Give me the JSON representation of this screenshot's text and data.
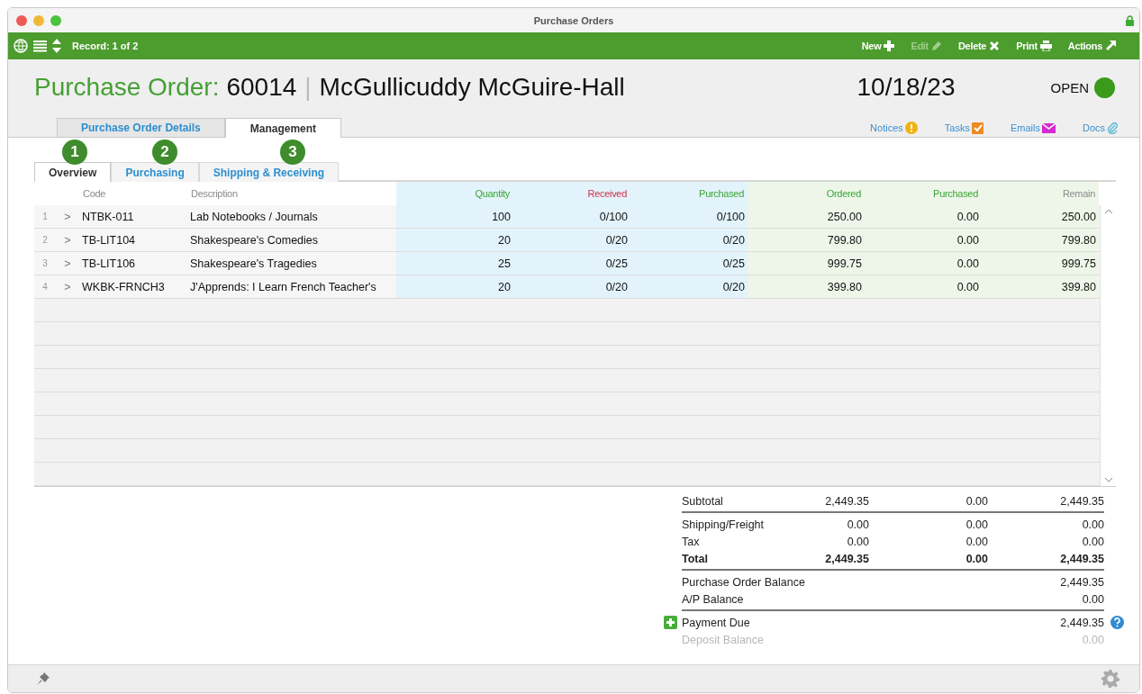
{
  "window": {
    "title": "Purchase Orders"
  },
  "toolbar": {
    "record": "Record: 1 of 2",
    "actions": [
      {
        "label": "New",
        "kind": "new",
        "disabled": false
      },
      {
        "label": "Edit",
        "kind": "edit",
        "disabled": true
      },
      {
        "label": "Delete",
        "kind": "delete",
        "disabled": false
      },
      {
        "label": "Print",
        "kind": "print",
        "disabled": false
      },
      {
        "label": "Actions",
        "kind": "actions",
        "disabled": false
      }
    ]
  },
  "header": {
    "label": "Purchase Order:",
    "number": "60014",
    "separator": "|",
    "vendor": "McGullicuddy McGuire-Hall",
    "date": "10/18/23",
    "status": "OPEN"
  },
  "links": [
    {
      "label": "Notices",
      "kind": "notices"
    },
    {
      "label": "Tasks",
      "kind": "tasks"
    },
    {
      "label": "Emails",
      "kind": "emails"
    },
    {
      "label": "Docs",
      "kind": "docs"
    }
  ],
  "tabs": [
    {
      "label": "Purchase Order Details",
      "selected": false
    },
    {
      "label": "Management",
      "selected": true
    }
  ],
  "subtabs": [
    {
      "label": "Overview",
      "selected": true
    },
    {
      "label": "Purchasing",
      "selected": false
    },
    {
      "label": "Shipping & Receiving",
      "selected": false
    }
  ],
  "callouts": [
    "1",
    "2",
    "3"
  ],
  "table": {
    "columns": [
      {
        "label": "Code",
        "color": "#8a8a8a",
        "kind": "text"
      },
      {
        "label": "Description",
        "color": "#8a8a8a",
        "kind": "text"
      },
      {
        "label": "Quantity",
        "color": "#3aa535",
        "kind": "quantity"
      },
      {
        "label": "Received",
        "color": "#d0314a",
        "kind": "quantity"
      },
      {
        "label": "Purchased",
        "color": "#3aa535",
        "kind": "quantity"
      },
      {
        "label": "Ordered",
        "color": "#3aa535",
        "kind": "amount"
      },
      {
        "label": "Purchased",
        "color": "#3aa535",
        "kind": "amount"
      },
      {
        "label": "Remain",
        "color": "#8a8a8a",
        "kind": "amount"
      }
    ],
    "rows": [
      {
        "num": "1",
        "expander": ">",
        "cells": [
          "NTBK-011",
          "Lab Notebooks / Journals",
          "100",
          "0/100",
          "0/100",
          "250.00",
          "0.00",
          "250.00"
        ]
      },
      {
        "num": "2",
        "expander": ">",
        "cells": [
          "TB-LIT104",
          "Shakespeare's Comedies",
          "20",
          "0/20",
          "0/20",
          "799.80",
          "0.00",
          "799.80"
        ]
      },
      {
        "num": "3",
        "expander": ">",
        "cells": [
          "TB-LIT106",
          "Shakespeare's Tragedies",
          "25",
          "0/25",
          "0/25",
          "999.75",
          "0.00",
          "999.75"
        ]
      },
      {
        "num": "4",
        "expander": ">",
        "cells": [
          "WKBK-FRNCH3",
          "J'Apprends: I Learn French Teacher's",
          "20",
          "0/20",
          "0/20",
          "399.80",
          "0.00",
          "399.80"
        ]
      }
    ]
  },
  "summary": [
    [
      {
        "label": "Subtotal",
        "values": [
          "2,449.35",
          "0.00",
          "2,449.35"
        ],
        "bold": false,
        "disabled": false
      }
    ],
    [
      {
        "label": "Shipping/Freight",
        "values": [
          "0.00",
          "0.00",
          "0.00"
        ],
        "bold": false,
        "disabled": false
      },
      {
        "label": "Tax",
        "values": [
          "0.00",
          "0.00",
          "0.00"
        ],
        "bold": false,
        "disabled": false
      },
      {
        "label": "Total",
        "values": [
          "2,449.35",
          "0.00",
          "2,449.35"
        ],
        "bold": true,
        "disabled": false
      }
    ],
    [
      {
        "label": "Purchase Order Balance",
        "values": [
          "2,449.35"
        ],
        "bold": false,
        "disabled": false
      },
      {
        "label": "A/P Balance",
        "values": [
          "0.00"
        ],
        "bold": false,
        "disabled": false
      }
    ],
    [
      {
        "label": "Payment Due",
        "values": [
          "2,449.35"
        ],
        "bold": false,
        "disabled": false,
        "add_button": true,
        "help": true
      },
      {
        "label": "Deposit Balance",
        "values": [
          "0.00"
        ],
        "bold": false,
        "disabled": true
      }
    ]
  ]
}
